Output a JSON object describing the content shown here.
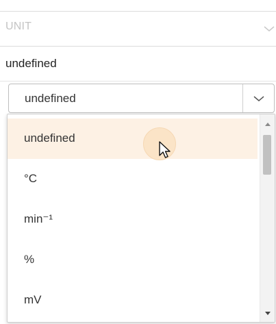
{
  "field": {
    "header_label": "UNIT",
    "current_value": "undefined"
  },
  "select": {
    "selected_label": "undefined"
  },
  "dropdown": {
    "options": [
      {
        "label": "undefined"
      },
      {
        "label": "°C"
      },
      {
        "label": "min⁻¹"
      },
      {
        "label": "%"
      },
      {
        "label": "mV"
      }
    ],
    "hovered_index": 0,
    "scroll_position": 0.08
  },
  "icons": {
    "header_chevron": "chevron-down-icon",
    "select_chevron": "chevron-down-icon",
    "cursor": "mouse-pointer-icon",
    "scroll_up": "scroll-up-arrow-icon",
    "scroll_down": "scroll-down-arrow-icon"
  },
  "colors": {
    "hover_background": "#fdf1e4",
    "ripple": "#fbe3c4",
    "header_text": "#c4c4c4"
  }
}
